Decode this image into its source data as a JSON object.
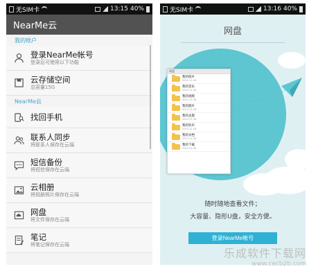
{
  "left": {
    "status": {
      "carrier": "无SIM卡",
      "time": "13:15",
      "battery": "40%"
    },
    "appbar": {
      "title": "NearMe云"
    },
    "sections": {
      "account": "我的帐户",
      "cloud": "NearMe云"
    },
    "rows": [
      {
        "title": "登录NearMe帐号",
        "sub": "登录后可使用以下功能",
        "icon": "person-icon"
      },
      {
        "title": "云存储空间",
        "sub": "总容量15G",
        "icon": "save-disk-icon"
      },
      {
        "title": "找回手机",
        "sub": "",
        "icon": "find-phone-icon"
      },
      {
        "title": "联系人同步",
        "sub": "将联系人保存在云端",
        "icon": "contacts-icon"
      },
      {
        "title": "短信备份",
        "sub": "将短信保存在云端",
        "icon": "sms-icon"
      },
      {
        "title": "云相册",
        "sub": "将相册照片保存在云端",
        "icon": "album-icon"
      },
      {
        "title": "网盘",
        "sub": "将文件保存在云端",
        "icon": "netdisk-icon"
      },
      {
        "title": "笔记",
        "sub": "将笔记保存在云端",
        "icon": "note-icon"
      }
    ]
  },
  "right": {
    "status": {
      "carrier": "无SIM卡",
      "time": "13:16",
      "battery": "40%"
    },
    "title": "网盘",
    "window_title": "网盘",
    "files": [
      {
        "name": "我的照片",
        "date": "2013-11-26"
      },
      {
        "name": "我的音乐",
        "date": "2013-11-26"
      },
      {
        "name": "我的视频",
        "date": "2013-11-26"
      },
      {
        "name": "我的图片",
        "date": "2013-11-26"
      },
      {
        "name": "我的主题",
        "date": "2013-11-26"
      },
      {
        "name": "我的铃声",
        "date": "2013-11-26"
      },
      {
        "name": "我的文档",
        "date": "2013-11-26"
      },
      {
        "name": "我的下载",
        "date": "2013-11-26"
      }
    ],
    "desc_line1": "随时随地查看文件；",
    "desc_line2": "大容量、隐形U盘，安全方便。",
    "login_button": "登录NearMe帐号"
  },
  "watermark": {
    "line1": "乐成软件下载网",
    "line2": "www.cecb2b.com"
  },
  "colors": {
    "accent": "#4aa3c8",
    "button": "#2fb1d4",
    "circle": "#5dc6d1",
    "appbar": "#525252"
  }
}
